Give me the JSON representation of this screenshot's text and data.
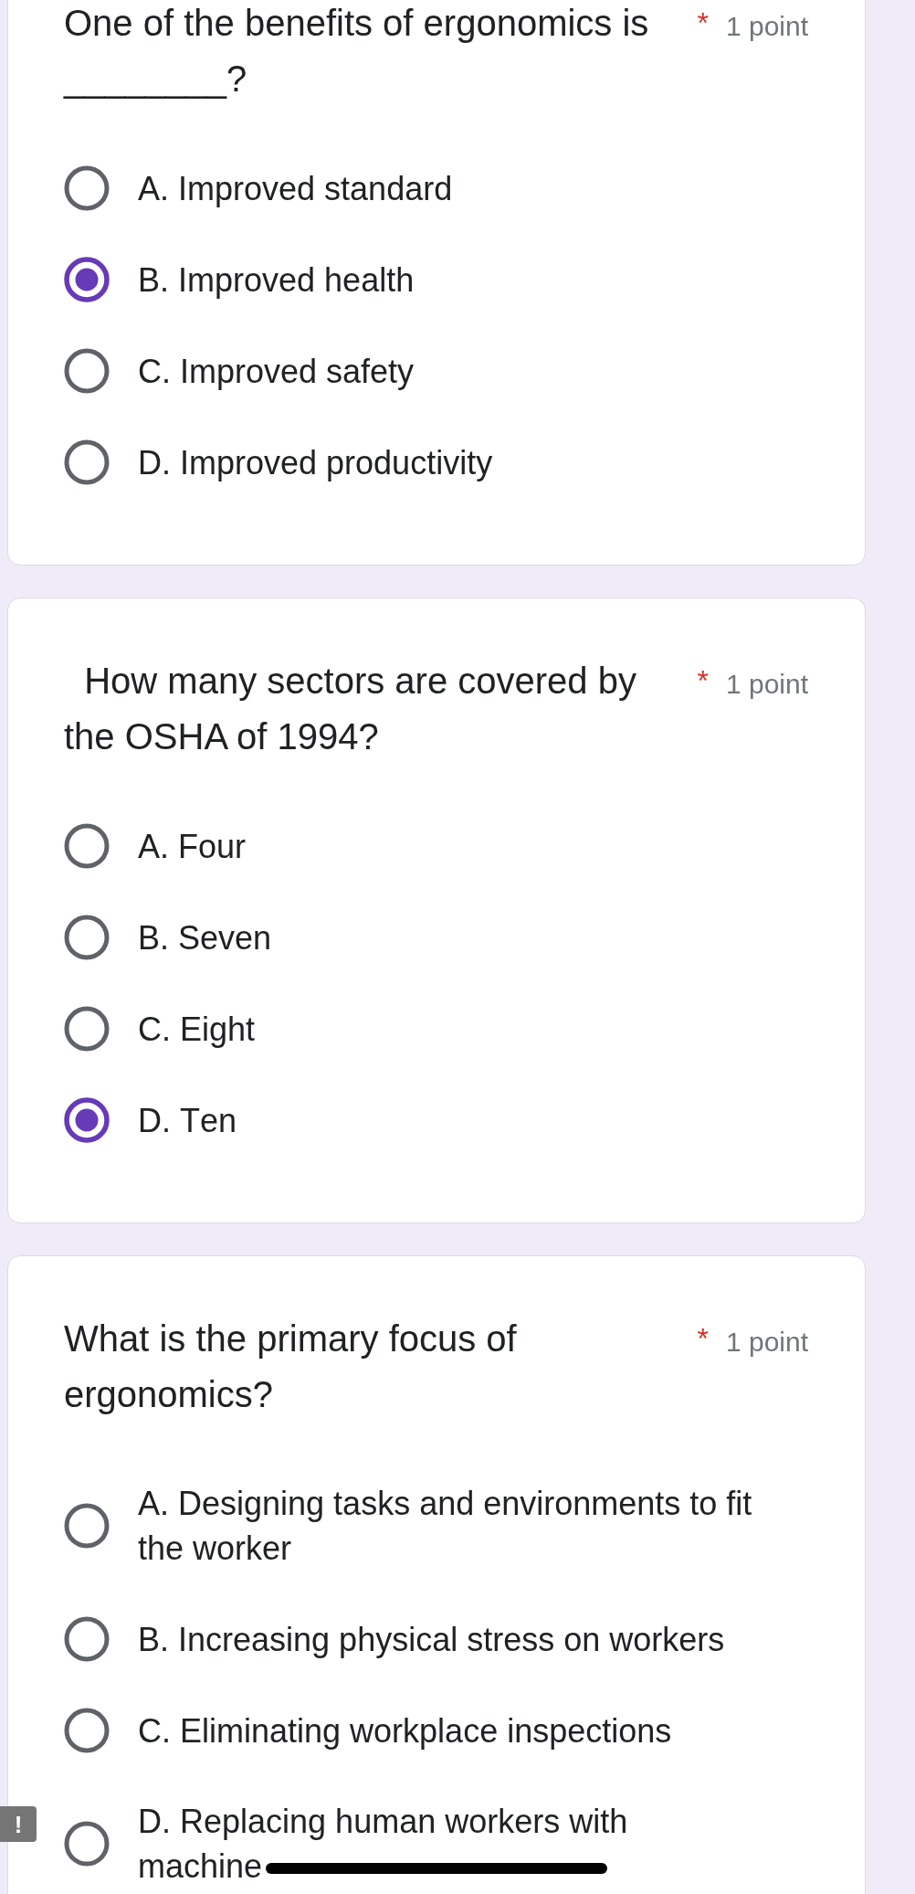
{
  "questions": [
    {
      "text": "One of the benefits of ergonomics is ________?",
      "required_mark": "*",
      "points": "1 point",
      "options": [
        {
          "label": "A. Improved standard",
          "selected": false
        },
        {
          "label": "B. Improved health",
          "selected": true
        },
        {
          "label": "C. Improved safety",
          "selected": false
        },
        {
          "label": "D. Improved productivity",
          "selected": false
        }
      ]
    },
    {
      "text": "  How many sectors are covered by the OSHA of 1994?",
      "required_mark": "*",
      "points": "1 point",
      "options": [
        {
          "label": "A. Four",
          "selected": false
        },
        {
          "label": "B. Seven",
          "selected": false
        },
        {
          "label": "C. Eight",
          "selected": false
        },
        {
          "label": "D. Ten",
          "selected": true
        }
      ]
    },
    {
      "text": "What is the primary focus of ergonomics?",
      "required_mark": "*",
      "points": "1 point",
      "options": [
        {
          "label": "A. Designing tasks and environments to fit the worker",
          "selected": false
        },
        {
          "label": "B. Increasing physical stress on workers",
          "selected": false
        },
        {
          "label": "C. Eliminating workplace inspections",
          "selected": false
        },
        {
          "label": "D. Replacing human workers with machine",
          "selected": false
        }
      ]
    }
  ],
  "side_tab": {
    "label": "!"
  }
}
